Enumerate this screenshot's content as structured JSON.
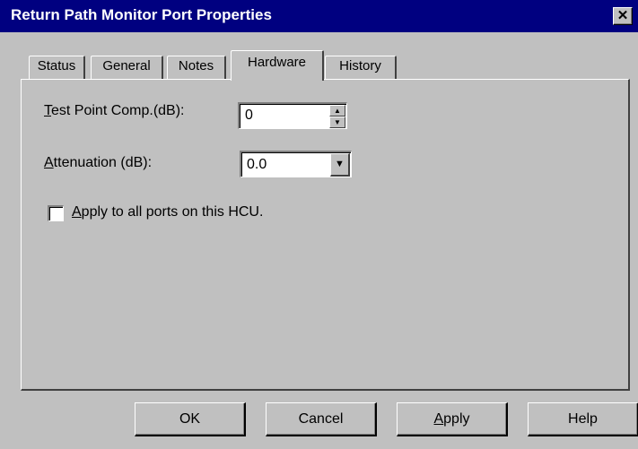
{
  "window": {
    "title": "Return Path Monitor Port Properties",
    "close_glyph": "✕"
  },
  "tabs": [
    {
      "label": "Status",
      "active": false
    },
    {
      "label": "General",
      "active": false
    },
    {
      "label": "Notes",
      "active": false
    },
    {
      "label": "Hardware",
      "active": true
    },
    {
      "label": "History",
      "active": false
    }
  ],
  "hardware": {
    "test_point_label_mnemonic": "T",
    "test_point_label_rest": "est Point Comp.(dB):",
    "test_point_value": "0",
    "attenuation_label_pre": "",
    "attenuation_label_mnemonic": "A",
    "attenuation_label_rest": "ttenuation (dB):",
    "attenuation_value": "0.0",
    "apply_all_mnemonic": "A",
    "apply_all_rest": "pply to all ports on this HCU.",
    "apply_all_checked": false
  },
  "buttons": {
    "ok": "OK",
    "cancel": "Cancel",
    "apply_mnemonic": "A",
    "apply_rest": "pply",
    "help": "Help"
  },
  "icons": {
    "spin_up": "▲",
    "spin_down": "▼",
    "dropdown_arrow": "▼"
  }
}
